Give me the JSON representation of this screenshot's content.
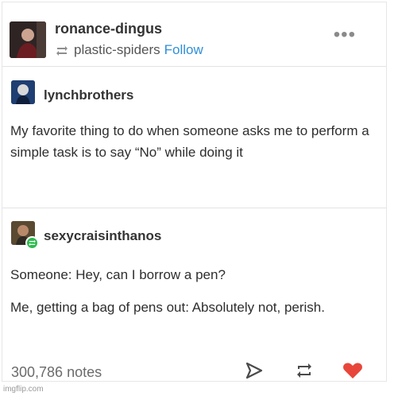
{
  "post": {
    "author": "ronance-dingus",
    "reblogged_from": "plastic-spiders",
    "follow_label": "Follow",
    "more_label": "•••"
  },
  "thread": [
    {
      "username": "lynchbrothers",
      "text": "My favorite thing to do when someone asks me to perform a simple task is to say “No” while doing it"
    },
    {
      "username": "sexycraisinthanos",
      "text_1": "Someone: Hey, can I borrow a pen?",
      "text_2": "Me, getting a bag of pens out: Absolutely not, perish."
    }
  ],
  "footer": {
    "notes": "300,786 notes"
  },
  "watermark": "imgflip.com",
  "colors": {
    "follow_link": "#2f8fda",
    "like_heart": "#e8463b",
    "reblog_badge": "#2dbb4f"
  },
  "icons": [
    "reblog-icon",
    "more-icon",
    "share-icon",
    "reblog-action-icon",
    "heart-icon"
  ]
}
